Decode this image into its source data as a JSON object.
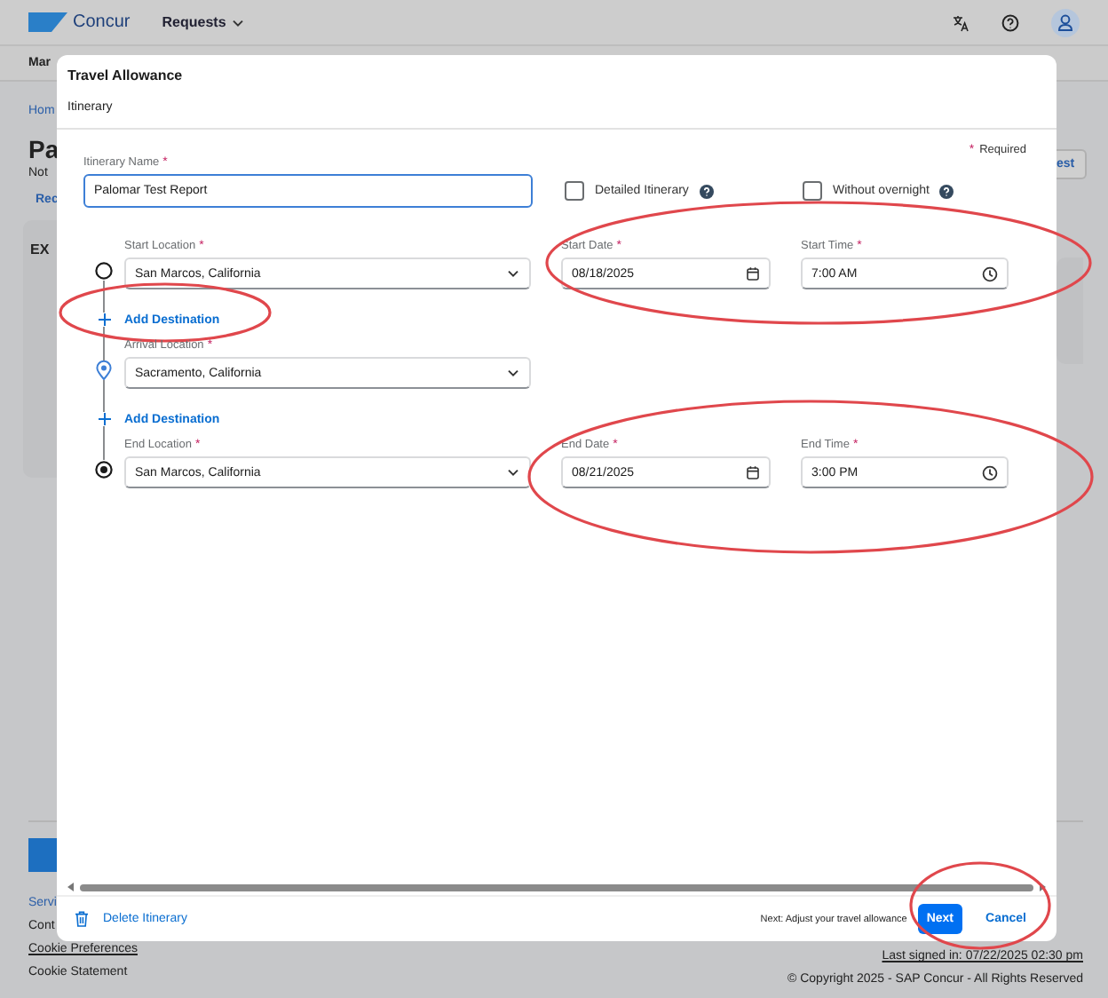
{
  "app_header": {
    "logo_text": "Concur",
    "menu": "Requests"
  },
  "background_page": {
    "nav": "Mar",
    "breadcrumb": "Hom",
    "title": "Pa",
    "status": "Not",
    "link": "Rec",
    "card_title": "EX",
    "button": "est"
  },
  "footer": {
    "links": [
      {
        "label": "Servi",
        "kind": "link"
      },
      {
        "label": "Cont",
        "kind": "plain"
      },
      {
        "label": "Cookie Preferences",
        "kind": "underlined"
      },
      {
        "label": "Cookie Statement",
        "kind": "plain"
      }
    ],
    "last_signed": "Last signed in: 07/22/2025 02:30 pm",
    "copyright": "© Copyright 2025 - SAP Concur - All Rights Reserved"
  },
  "dialog": {
    "title": "Travel Allowance",
    "tab": "Itinerary",
    "required_mark": "*",
    "required_note": "Required",
    "itinerary_name": {
      "label": "Itinerary Name",
      "required": true,
      "value": "Palomar Test Report"
    },
    "options": [
      {
        "label": "Detailed Itinerary",
        "checked": false
      },
      {
        "label": "Without overnight",
        "checked": false
      }
    ],
    "stops": [
      {
        "kind": "start",
        "location": {
          "label": "Start Location",
          "required": true,
          "value": "San Marcos, California"
        },
        "date": {
          "label": "Start Date",
          "required": true,
          "value": "08/18/2025"
        },
        "time": {
          "label": "Start Time",
          "required": true,
          "value": "7:00 AM"
        },
        "highlight": true
      },
      {
        "kind": "add",
        "label": "Add Destination",
        "highlight": true
      },
      {
        "kind": "arrival",
        "location": {
          "label": "Arrival Location",
          "required": true,
          "value": "Sacramento, California"
        }
      },
      {
        "kind": "add",
        "label": "Add Destination"
      },
      {
        "kind": "end",
        "location": {
          "label": "End Location",
          "required": true,
          "value": "San Marcos, California"
        },
        "date": {
          "label": "End Date",
          "required": true,
          "value": "08/21/2025"
        },
        "time": {
          "label": "End Time",
          "required": true,
          "value": "3:00 PM"
        },
        "highlight": true
      }
    ],
    "delete_label": "Delete Itinerary",
    "next_hint": "Next: Adjust your travel allowance",
    "actions": [
      {
        "label": "Next",
        "kind": "primary"
      },
      {
        "label": "Cancel",
        "kind": "link"
      }
    ],
    "actions_highlight": true
  }
}
